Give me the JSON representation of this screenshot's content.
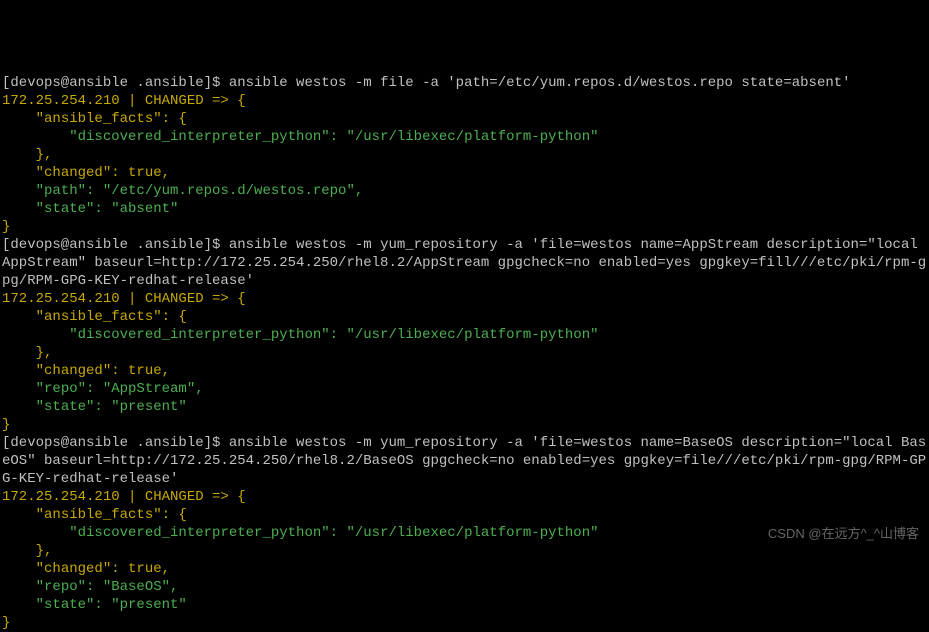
{
  "cmd1": {
    "prompt": "[devops@ansible .ansible]$ ",
    "command": "ansible westos -m file -a 'path=/etc/yum.repos.d/westos.repo state=absent'",
    "host_line": "172.25.254.210 | CHANGED => {",
    "facts_key": "    \"ansible_facts\": {",
    "interp": "        \"discovered_interpreter_python\": \"/usr/libexec/platform-python\"",
    "facts_close": "    },",
    "changed": "    \"changed\": true,",
    "path": "    \"path\": \"/etc/yum.repos.d/westos.repo\",",
    "state": "    \"state\": \"absent\"",
    "close": "}"
  },
  "cmd2": {
    "prompt": "[devops@ansible .ansible]$ ",
    "command": "ansible westos -m yum_repository -a 'file=westos name=AppStream description=\"local AppStream\" baseurl=http://172.25.254.250/rhel8.2/AppStream gpgcheck=no enabled=yes gpgkey=fill///etc/pki/rpm-gpg/RPM-GPG-KEY-redhat-release'",
    "host_line": "172.25.254.210 | CHANGED => {",
    "facts_key": "    \"ansible_facts\": {",
    "interp": "        \"discovered_interpreter_python\": \"/usr/libexec/platform-python\"",
    "facts_close": "    },",
    "changed": "    \"changed\": true,",
    "repo": "    \"repo\": \"AppStream\",",
    "state": "    \"state\": \"present\"",
    "close": "}"
  },
  "cmd3": {
    "prompt": "[devops@ansible .ansible]$ ",
    "command": "ansible westos -m yum_repository -a 'file=westos name=BaseOS description=\"local BaseOS\" baseurl=http://172.25.254.250/rhel8.2/BaseOS gpgcheck=no enabled=yes gpgkey=file///etc/pki/rpm-gpg/RPM-GPG-KEY-redhat-release'",
    "host_line": "172.25.254.210 | CHANGED => {",
    "facts_key": "    \"ansible_facts\": {",
    "interp": "        \"discovered_interpreter_python\": \"/usr/libexec/platform-python\"",
    "facts_close": "    },",
    "changed": "    \"changed\": true,",
    "repo": "    \"repo\": \"BaseOS\",",
    "state": "    \"state\": \"present\"",
    "close": "}"
  },
  "watermark": "CSDN @在远方^_^山博客"
}
